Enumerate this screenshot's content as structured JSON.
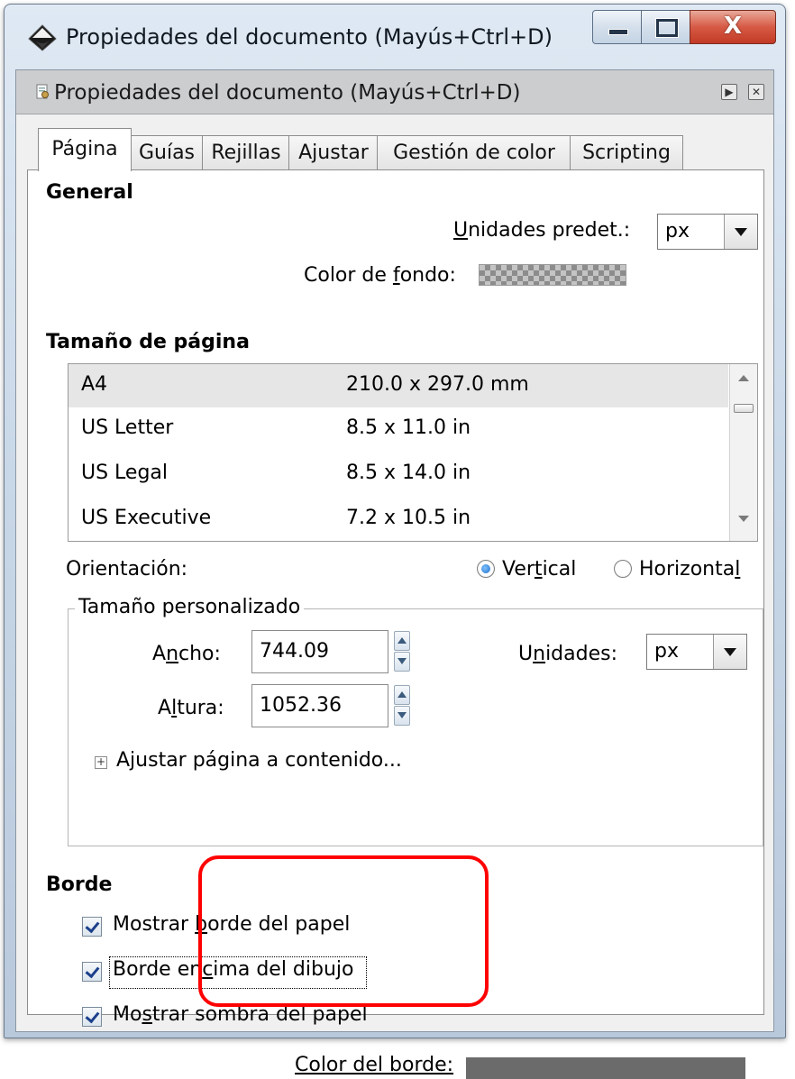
{
  "window": {
    "title": "Propiedades del documento (Mayús+Ctrl+D)",
    "close_glyph": "X"
  },
  "dock": {
    "title": "Propiedades del documento (Mayús+Ctrl+D)",
    "float_glyph": "▶",
    "close_glyph": "✕"
  },
  "tabs": [
    {
      "label": "Página"
    },
    {
      "label": "Guías"
    },
    {
      "label": "Rejillas"
    },
    {
      "label": "Ajustar"
    },
    {
      "label": "Gestión de color"
    },
    {
      "label": "Scripting"
    }
  ],
  "general": {
    "heading": "General",
    "units_label_u": "U",
    "units_label_rest": "nidades predet.:",
    "units_value": "px",
    "bg_label_pre": "Color de ",
    "bg_label_u": "f",
    "bg_label_rest": "ondo:"
  },
  "page_size": {
    "heading": "Tamaño de página",
    "rows": [
      {
        "name": "A4",
        "size": "210.0 x 297.0 mm"
      },
      {
        "name": "US Letter",
        "size": "8.5 x 11.0 in"
      },
      {
        "name": "US Legal",
        "size": "8.5 x 14.0 in"
      },
      {
        "name": "US Executive",
        "size": "7.2 x 10.5 in"
      }
    ],
    "orientation_label": "Orientación:",
    "vertical_pre": "Ver",
    "vertical_u": "t",
    "vertical_rest": "ical",
    "horizontal_pre": "Horizonta",
    "horizontal_u": "l",
    "horizontal_selected": false,
    "vertical_selected": true
  },
  "custom_size": {
    "legend": "Tamaño personalizado",
    "width_pre": "A",
    "width_u": "n",
    "width_rest": "cho:",
    "width_value": "744.09",
    "height_pre": "A",
    "height_u": "l",
    "height_rest": "tura:",
    "height_value": "1052.36",
    "units_pre": "U",
    "units_u": "n",
    "units_rest": "idades:",
    "units_value": "px",
    "expander_glyph": "+",
    "fit_label": "Ajustar página a contenido..."
  },
  "border": {
    "heading": "Borde",
    "show_border_pre": "Mostrar ",
    "show_border_u": "b",
    "show_border_rest": "orde del papel",
    "border_on_top_pre": "Borde en",
    "border_on_top_u": "c",
    "border_on_top_rest": "ima del dibujo",
    "show_shadow_pre": "Mo",
    "show_shadow_u": "s",
    "show_shadow_rest": "trar sombra del papel",
    "color_label": "Color del borde:",
    "color_value": "#6b6b6b"
  },
  "annotation": {
    "color": "#ff0000"
  }
}
